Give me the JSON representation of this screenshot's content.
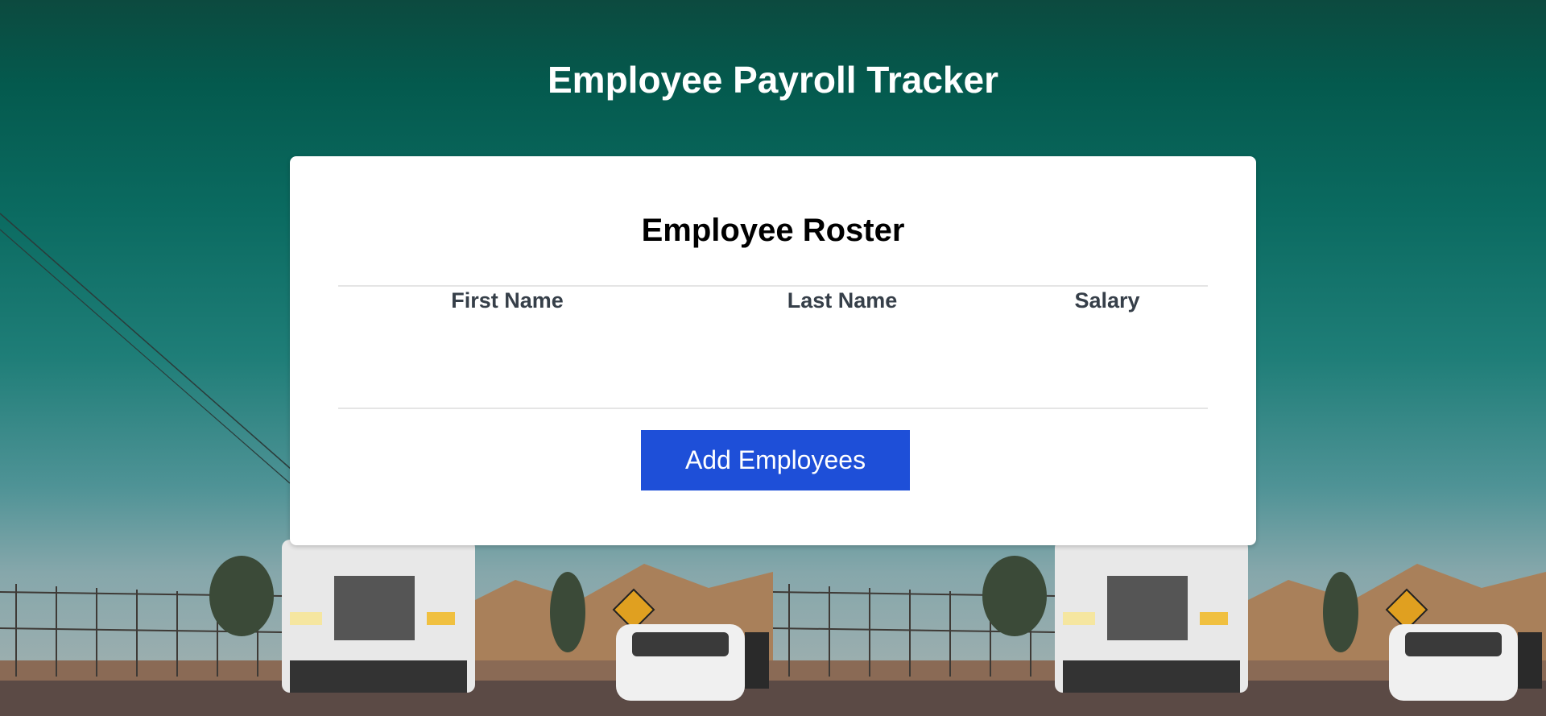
{
  "page": {
    "title": "Employee Payroll Tracker"
  },
  "roster": {
    "title": "Employee Roster",
    "columns": {
      "first_name": "First Name",
      "last_name": "Last Name",
      "salary": "Salary"
    },
    "rows": []
  },
  "actions": {
    "add_employees_label": "Add Employees"
  },
  "colors": {
    "button_bg": "#1e4fd8",
    "background_top": "#0c4a3f"
  }
}
